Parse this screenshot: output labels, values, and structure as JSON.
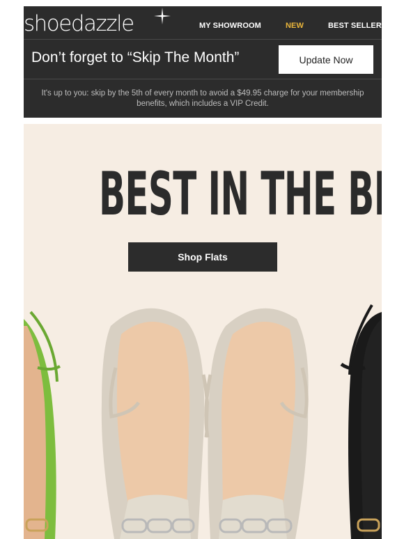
{
  "header": {
    "logo_text": "shoedazzle",
    "nav": [
      {
        "label": "MY SHOWROOM"
      },
      {
        "label": "NEW"
      },
      {
        "label": "BEST SELLERS"
      }
    ]
  },
  "reminder": {
    "title": "Don’t forget to “Skip The Month”",
    "button_label": "Update Now"
  },
  "notice": {
    "text": "It's up to you: skip by the 5th of every month to avoid a $49.95 charge for your membership benefits, which includes a VIP Credit."
  },
  "hero": {
    "headline": "BEST IN THE BIZ",
    "button_label": "Shop Flats",
    "image_alt": "slingback flats"
  },
  "colors": {
    "dark": "#2c2c2c",
    "accent": "#e9b53b",
    "cream": "#f6ede3",
    "green_shoe": "#7dbd3e",
    "snake_shoe": "#d8d0c3",
    "black_shoe": "#1a1a1a"
  }
}
